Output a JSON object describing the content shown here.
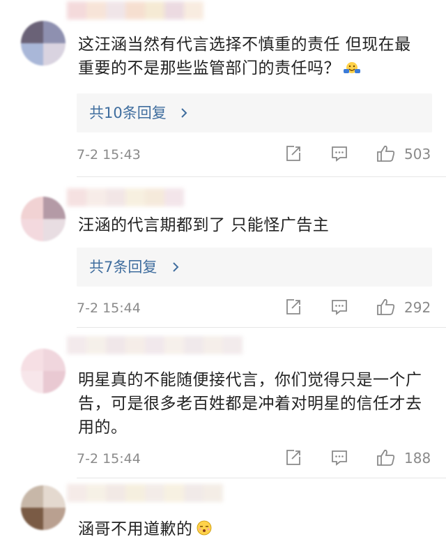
{
  "comments": [
    {
      "text": "这汪涵当然有代言选择不慎重的责任 但现在最重要的不是那些监管部门的责任吗？",
      "emoji_icon": "hug-emoji-icon",
      "replies_label": "共10条回复",
      "time": "7-2 15:43",
      "likes": "503"
    },
    {
      "text": "汪涵的代言期都到了 只能怪广告主",
      "replies_label": "共7条回复",
      "time": "7-2 15:44",
      "likes": "292"
    },
    {
      "text": "明星真的不能随便接代言，你们觉得只是一个广告，可是很多老百姓都是冲着对明星的信任才去用的。",
      "time": "7-2 15:44",
      "likes": "188"
    },
    {
      "text": "涵哥不用道歉的",
      "emoji_icon": "awkward-face-emoji-icon"
    }
  ],
  "colors": {
    "link_blue": "#3f6d9e",
    "meta_gray": "#8a8a8a",
    "reply_bg": "#f6f6f6",
    "divider": "#e6e6e6"
  },
  "icons": {
    "share": "share-icon",
    "comment": "comment-icon",
    "like": "thumbs-up-icon",
    "reply_more": "chevron-right-icon"
  }
}
